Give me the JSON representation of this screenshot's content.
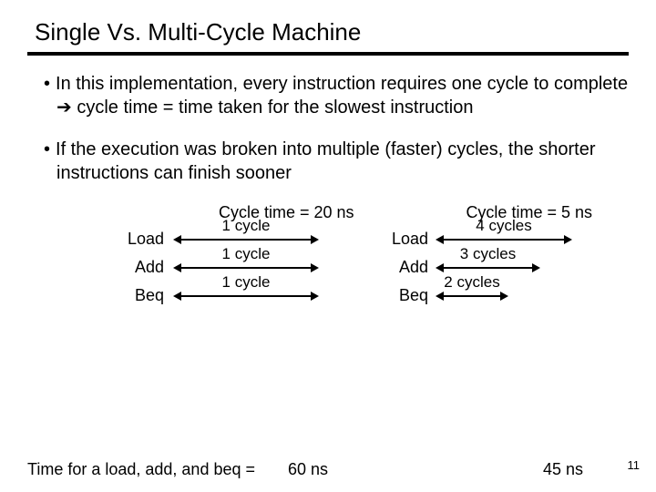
{
  "title": "Single Vs. Multi-Cycle Machine",
  "bullets": [
    "In this implementation, every instruction requires one cycle to complete ➔ cycle time = time taken for the slowest instruction",
    "If the execution was broken into multiple (faster) cycles, the shorter instructions can finish sooner"
  ],
  "left": {
    "header": "Cycle time = 20 ns",
    "rows": [
      {
        "label": "Load",
        "caption": "1 cycle"
      },
      {
        "label": "Add",
        "caption": "1 cycle"
      },
      {
        "label": "Beq",
        "caption": "1 cycle"
      }
    ]
  },
  "right": {
    "header": "Cycle time = 5 ns",
    "rows": [
      {
        "label": "Load",
        "caption": "4 cycles"
      },
      {
        "label": "Add",
        "caption": "3 cycles"
      },
      {
        "label": "Beq",
        "caption": "2 cycles"
      }
    ]
  },
  "footer": {
    "text": "Time for a load, add, and beq =",
    "val1": "60 ns",
    "val2": "45 ns"
  },
  "page": "11"
}
